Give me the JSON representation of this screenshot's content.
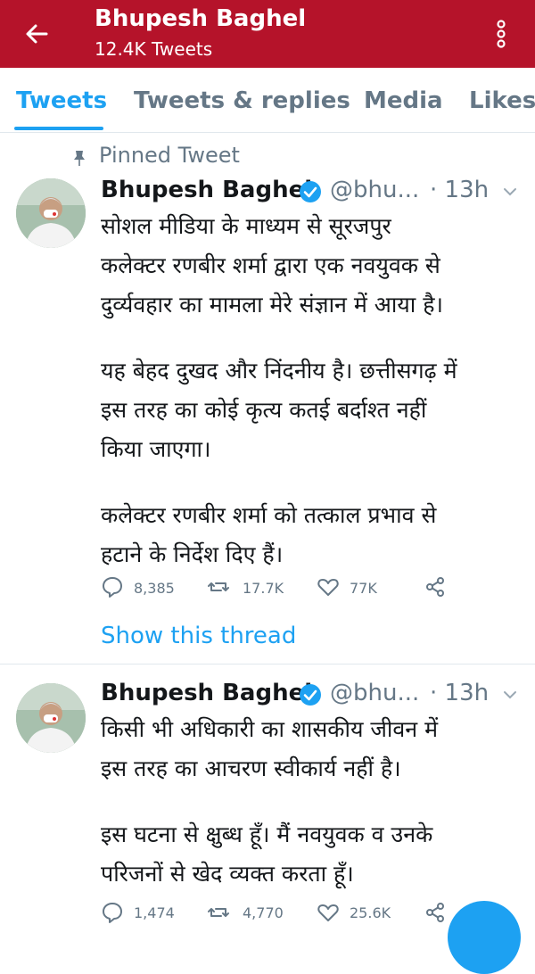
{
  "header": {
    "title": "Bhupesh Baghel",
    "subtitle": "12.4K Tweets",
    "back_icon": "arrow-left-icon",
    "menu_icon": "more-vertical-icon",
    "color": "#b5132a"
  },
  "tabs": [
    {
      "label": "Tweets",
      "active": true
    },
    {
      "label": "Tweets & replies",
      "active": false
    },
    {
      "label": "Media",
      "active": false
    },
    {
      "label": "Likes",
      "active": false
    }
  ],
  "accent_color": "#1da1f2",
  "pinned_label": "Pinned Tweet",
  "tweets": [
    {
      "name": "Bhupesh Baghel",
      "handle": "@bhu...",
      "time": "· 13h",
      "lines": [
        "सोशल मीडिया के माध्यम से सूरजपुर",
        "कलेक्टर रणबीर शर्मा द्वारा एक नवयुवक से",
        "दुर्व्यवहार का मामला मेरे संज्ञान में आया है।",
        "यह बेहद दुखद और निंदनीय है। छत्तीसगढ़ में",
        "इस तरह का कोई कृत्य कतई बर्दाश्त नहीं",
        "किया जाएगा।",
        "कलेक्टर रणबीर शर्मा को तत्काल प्रभाव से",
        "हटाने के निर्देश दिए हैं।"
      ],
      "replies": "8,385",
      "retweets": "17.7K",
      "likes": "77K",
      "show_thread": "Show this thread"
    },
    {
      "name": "Bhupesh Baghel",
      "handle": "@bhu...",
      "time": "· 13h",
      "lines": [
        "किसी भी अधिकारी का शासकीय जीवन में",
        "इस तरह का आचरण स्वीकार्य नहीं है।",
        "इस घटना से क्षुब्ध हूँ। मैं नवयुवक व उनके",
        "परिजनों से खेद व्यक्त करता हूँ।"
      ],
      "replies": "1,474",
      "retweets": "4,770",
      "likes": "25.6K"
    }
  ]
}
